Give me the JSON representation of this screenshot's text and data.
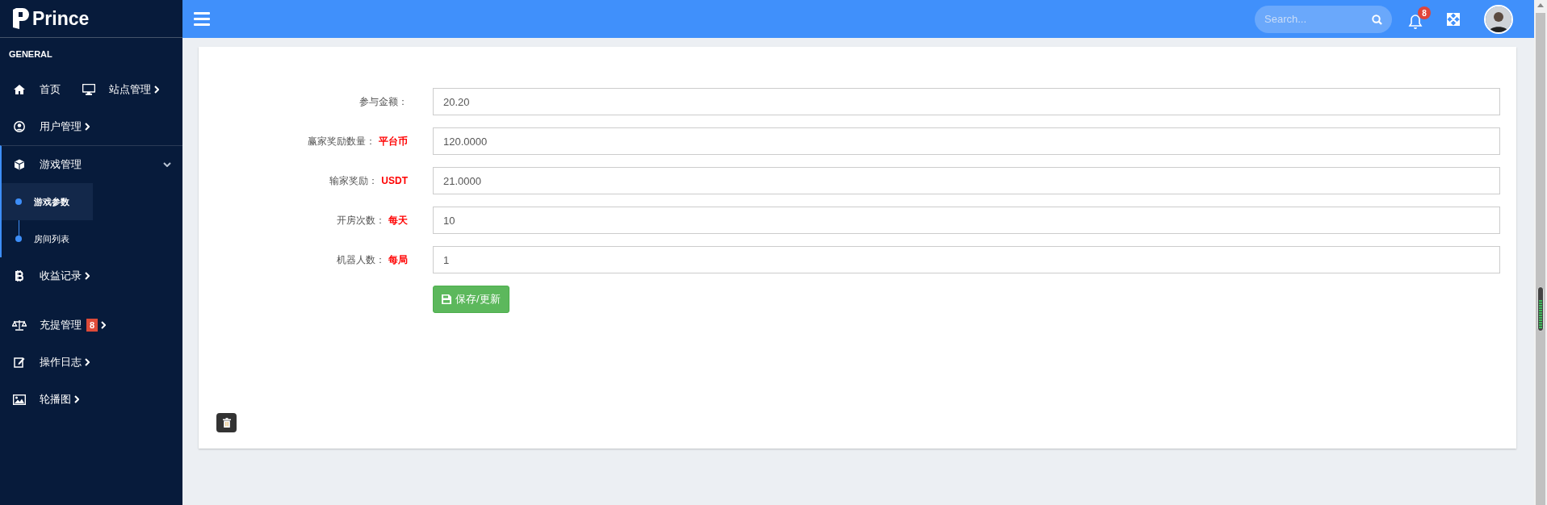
{
  "brand": {
    "name": "Prince"
  },
  "sidebar": {
    "section": "GENERAL",
    "rows": [
      [
        {
          "label": "首页",
          "kind": "link"
        },
        {
          "label": "站点管理",
          "kind": "menu",
          "expanded": false
        }
      ],
      [
        {
          "label": "用户管理",
          "kind": "menu",
          "expanded": false
        }
      ],
      [
        {
          "label": "游戏管理",
          "kind": "menu",
          "expanded": true,
          "children": [
            {
              "label": "游戏参数",
              "selected": true
            },
            {
              "label": "房间列表",
              "selected": false
            }
          ]
        }
      ],
      [
        {
          "label": "收益记录",
          "kind": "menu",
          "expanded": false
        }
      ],
      [
        {
          "label": "充提管理",
          "kind": "menu",
          "expanded": false,
          "badge": "8"
        }
      ],
      [
        {
          "label": "操作日志",
          "kind": "menu",
          "expanded": false
        }
      ],
      [
        {
          "label": "轮播图",
          "kind": "menu",
          "expanded": false
        }
      ]
    ]
  },
  "topbar": {
    "search": {
      "placeholder": "Search..."
    },
    "notifications": {
      "badge": "8"
    }
  },
  "form": {
    "fields": [
      {
        "label": "参与金额：",
        "value": "20.20"
      },
      {
        "label": "赢家奖励数量：",
        "unit": "平台币",
        "value": "120.0000"
      },
      {
        "label": "输家奖励：",
        "unit": "USDT",
        "value": "21.0000"
      },
      {
        "label": "开房次数：",
        "unit": "每天",
        "value": "10"
      },
      {
        "label": "机器人数：",
        "unit": "每局",
        "value": "1"
      }
    ],
    "submit": "保存/更新"
  }
}
